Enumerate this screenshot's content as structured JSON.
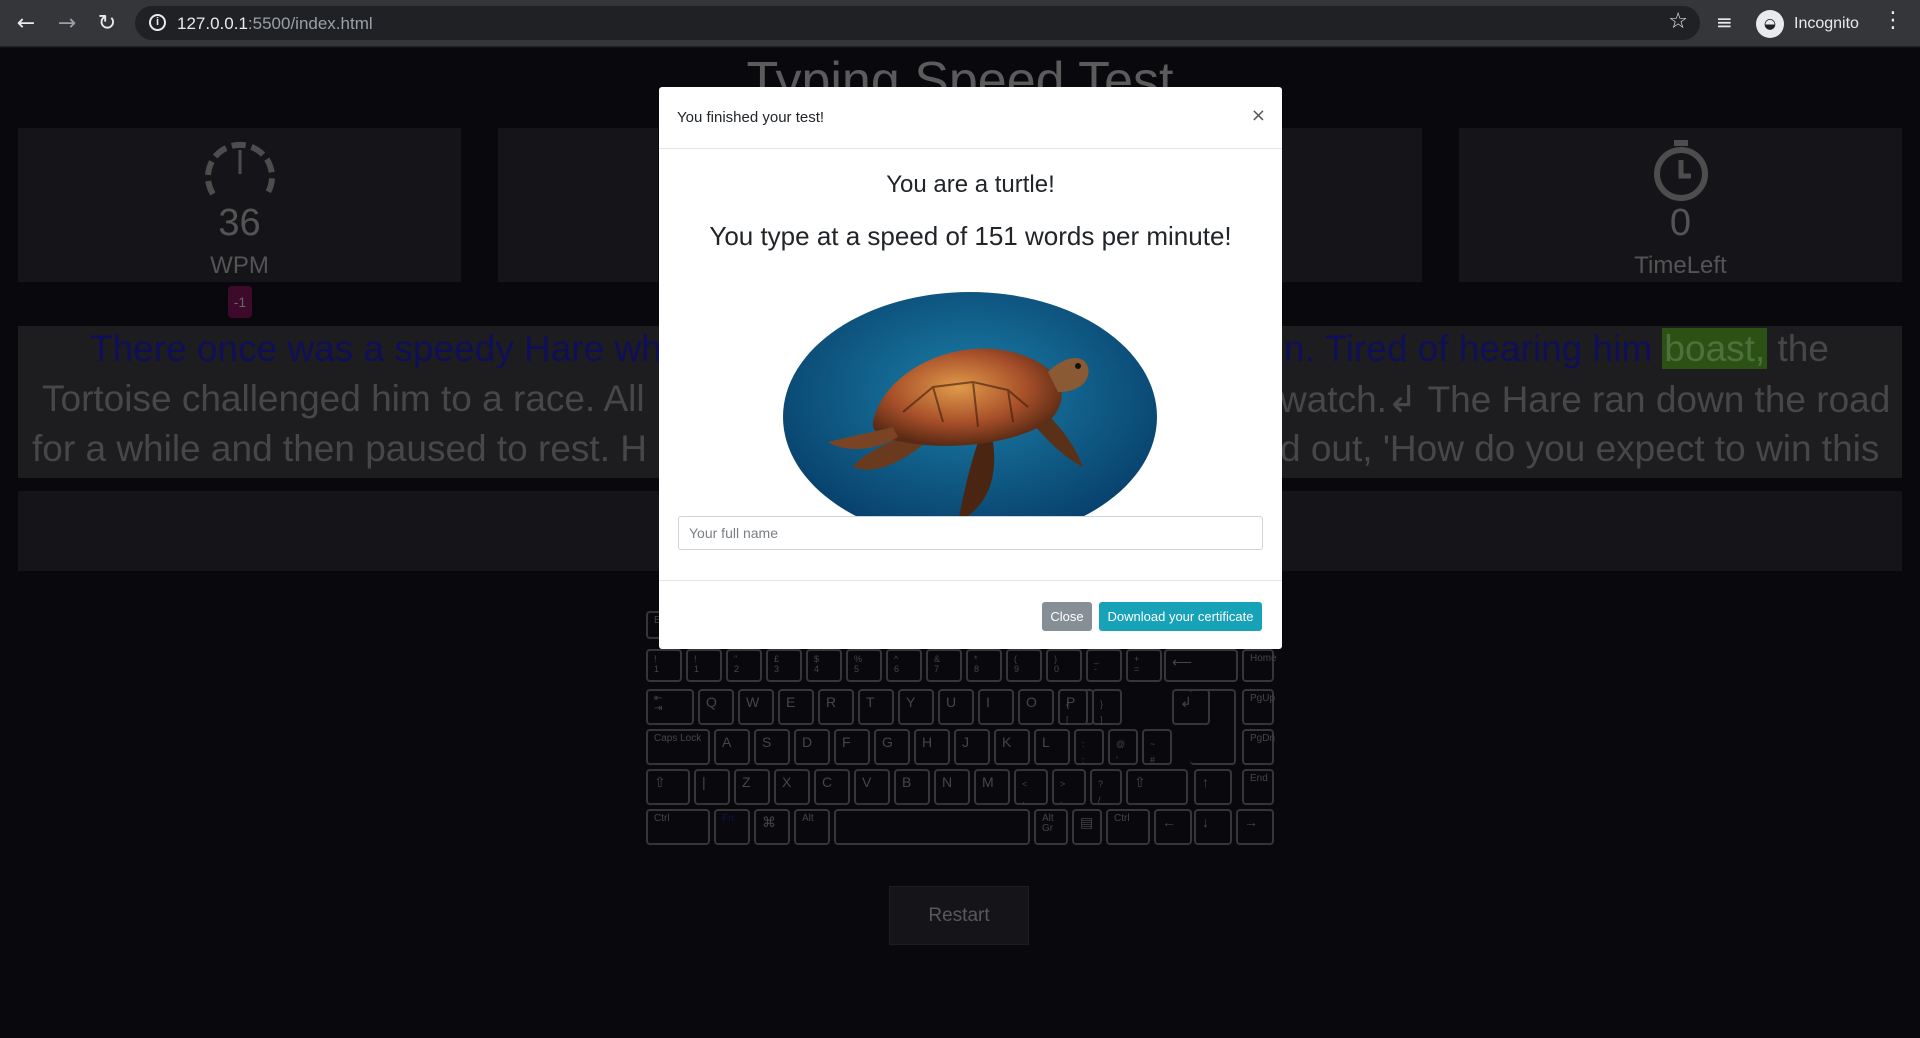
{
  "browser": {
    "url_host": "127.0.0.1",
    "url_rest": ":5500/index.html",
    "profile_label": "Incognito"
  },
  "page": {
    "title": "Typing Speed Test",
    "wpm": {
      "value": "36",
      "label": "WPM",
      "badge": "-1"
    },
    "timeleft": {
      "value": "0",
      "label": "TimeLeft"
    },
    "text": {
      "line1_typed_a": "There once was a speedy Hare wh",
      "line1_typed_b": "n. Tired of hearing him ",
      "line1_current": "boast,",
      "line1_rest": " the",
      "line2_a": "Tortoise challenged him to a race. All",
      "line2_b": "watch.↲ The Hare ran down the road",
      "line3_a": "for a while and then paused to rest. H",
      "line3_b": "d out, 'How do you expect to win this"
    },
    "restart_label": "Restart"
  },
  "keyboard": {
    "row1": [
      [
        "~",
        "!",
        "1"
      ],
      [
        "",
        "!",
        "1"
      ],
      [
        "",
        "\"",
        "2"
      ],
      [
        "",
        "£",
        "3"
      ],
      [
        "",
        "$",
        "4"
      ],
      [
        "",
        "%",
        "5"
      ],
      [
        "",
        "^",
        "6"
      ],
      [
        "",
        "&",
        "7"
      ],
      [
        "",
        "*",
        "8"
      ],
      [
        "",
        "(",
        "9"
      ],
      [
        "",
        ")",
        "0"
      ],
      [
        "",
        "_",
        "-"
      ],
      [
        "",
        "+",
        "="
      ]
    ],
    "row2": [
      "Q",
      "W",
      "E",
      "R",
      "T",
      "Y",
      "U",
      "I",
      "O",
      "P"
    ],
    "row3": [
      "A",
      "S",
      "D",
      "F",
      "G",
      "H",
      "J",
      "K",
      "L"
    ],
    "row4": [
      "Z",
      "X",
      "C",
      "V",
      "B",
      "N",
      "M"
    ],
    "labels": {
      "caps": "Caps Lock",
      "ctrl": "Ctrl",
      "alt": "Alt",
      "altgr": "Alt Gr",
      "home": "Home",
      "pgup": "PgUp",
      "pgdn": "PgDn",
      "end": "End"
    }
  },
  "modal": {
    "title": "You finished your test!",
    "close_icon": "×",
    "message1": "You are a turtle!",
    "message2": "You type at a speed of 151 words per minute!",
    "name_placeholder": "Your full name",
    "close_label": "Close",
    "download_label": "Download your certificate"
  }
}
